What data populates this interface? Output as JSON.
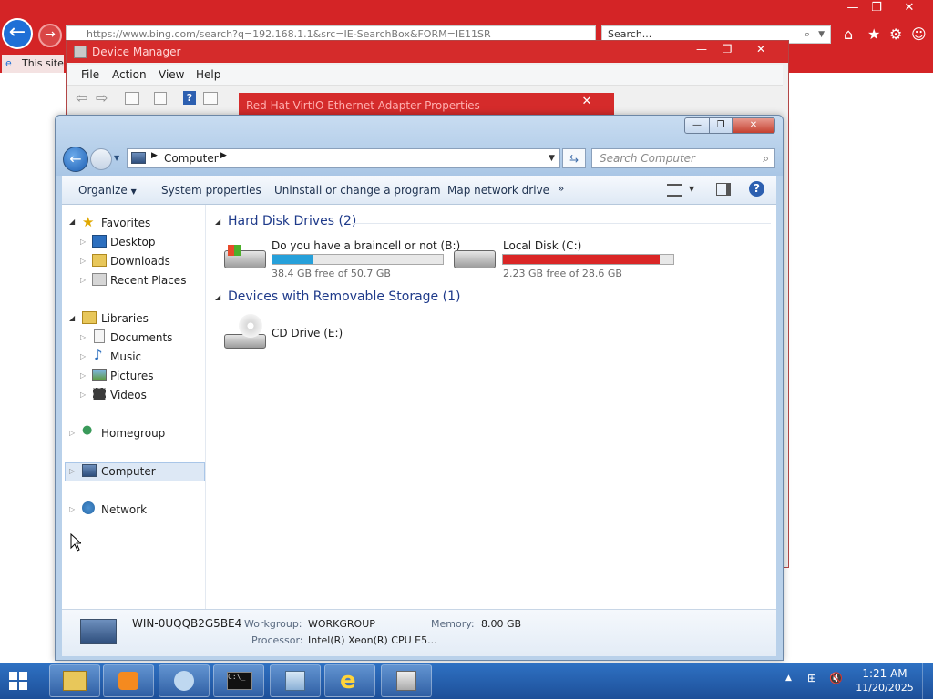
{
  "ie": {
    "address": "https://www.bing.com/search?q=192.168.1.1&src=IE-SearchBox&FORM=IE11SR",
    "search_placeholder": "Search...",
    "tab_label": "This site",
    "ctrl_min": "—",
    "ctrl_max": "❐",
    "ctrl_close": "✕"
  },
  "device_manager": {
    "title": "Device Manager",
    "menu": [
      "File",
      "Action",
      "View",
      "Help"
    ]
  },
  "redhat_dialog": {
    "title": "Red Hat VirtIO Ethernet Adapter Properties"
  },
  "explorer": {
    "breadcrumb": "Computer",
    "search_placeholder": "Search Computer",
    "commands": {
      "organize": "Organize",
      "system_properties": "System properties",
      "uninstall": "Uninstall or change a program",
      "map_drive": "Map network drive",
      "more": "»"
    },
    "nav": {
      "favorites": "Favorites",
      "desktop": "Desktop",
      "downloads": "Downloads",
      "recent_places": "Recent Places",
      "libraries": "Libraries",
      "documents": "Documents",
      "music": "Music",
      "pictures": "Pictures",
      "videos": "Videos",
      "homegroup": "Homegroup",
      "computer": "Computer",
      "network": "Network"
    },
    "groups": {
      "hard_disks": "Hard Disk Drives (2)",
      "removable": "Devices with Removable Storage (1)"
    },
    "drives": [
      {
        "name": "Do you have a braincell or not (B:)",
        "free_text": "38.4 GB free of 50.7 GB",
        "used_fraction": 0.243,
        "bar_color": "#26a0da"
      },
      {
        "name": "Local Disk (C:)",
        "free_text": "2.23 GB free of 28.6 GB",
        "used_fraction": 0.922,
        "bar_color": "#da2626"
      }
    ],
    "cd_drive": "CD Drive (E:)",
    "details": {
      "computer_name": "WIN-0UQQB2G5BE4",
      "workgroup_label": "Workgroup:",
      "workgroup": "WORKGROUP",
      "memory_label": "Memory:",
      "memory": "8.00 GB",
      "processor_label": "Processor:",
      "processor": "Intel(R) Xeon(R) CPU E5..."
    }
  },
  "taskbar": {
    "time": "1:21 AM",
    "date": "11/20/2025"
  }
}
